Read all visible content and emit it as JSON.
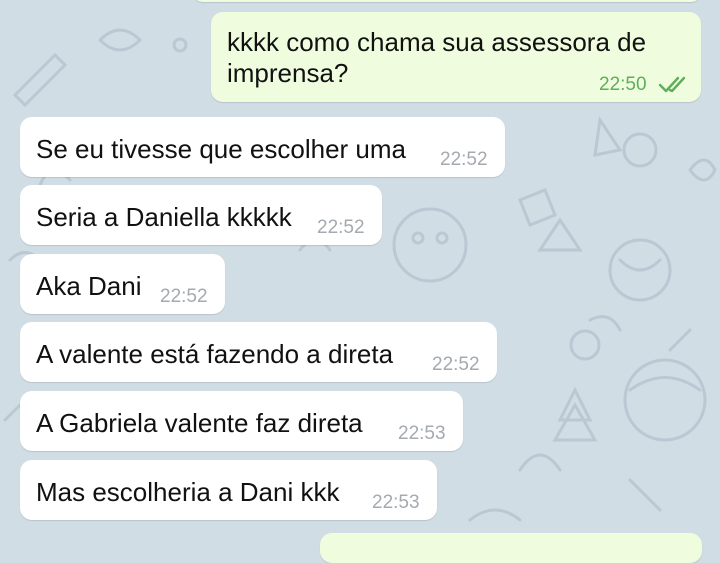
{
  "chat": {
    "outgoing": [
      {
        "text_line1": "kkkk como chama sua assessora de",
        "text_line2": "imprensa?",
        "time": "22:50",
        "status": "read"
      }
    ],
    "incoming": [
      {
        "text": "Se eu tivesse que escolher uma",
        "time": "22:52"
      },
      {
        "text": "Seria a Daniella kkkkk",
        "time": "22:52"
      },
      {
        "text": "Aka Dani",
        "time": "22:52"
      },
      {
        "text": "A valente está fazendo a direta",
        "time": "22:52"
      },
      {
        "text": "A Gabriela valente faz direta",
        "time": "22:53"
      },
      {
        "text": "Mas escolheria a Dani kkk",
        "time": "22:53"
      }
    ]
  },
  "colors": {
    "wallpaper": "#d1dde5",
    "incoming_bubble": "#ffffff",
    "outgoing_bubble": "#effdde",
    "outgoing_time": "#5fae5a",
    "incoming_time": "#a4aab0"
  },
  "icons": [
    "double-check-icon"
  ]
}
